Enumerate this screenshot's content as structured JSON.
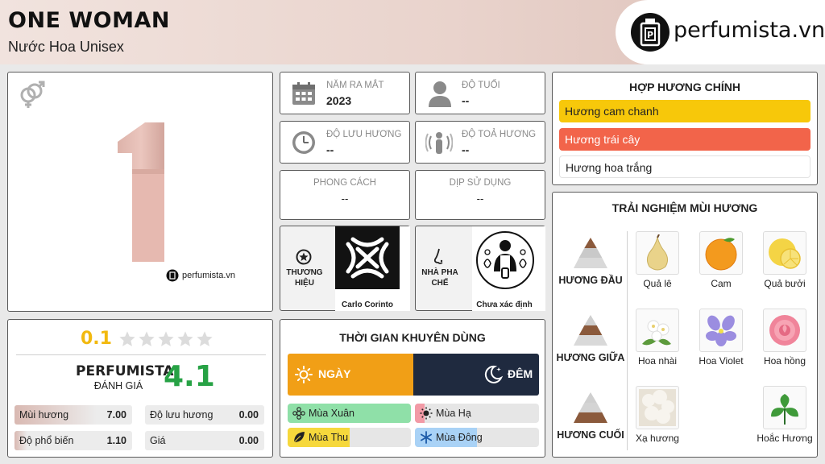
{
  "header": {
    "title": "ONE WOMAN",
    "subtitle": "Nước Hoa Unisex",
    "logo_text": "perfumista.vn"
  },
  "product": {
    "watermark": "perfumista.vn"
  },
  "info": {
    "launch_year": {
      "label": "NĂM RA MẮT",
      "value": "2023"
    },
    "age": {
      "label": "ĐỘ TUỔI",
      "value": "--"
    },
    "longevity": {
      "label": "ĐỘ LƯU HƯƠNG",
      "value": "--"
    },
    "sillage": {
      "label": "ĐỘ TOẢ HƯƠNG",
      "value": "--"
    },
    "style": {
      "label": "PHONG CÁCH",
      "value": "--"
    },
    "occasion": {
      "label": "DỊP SỬ DỤNG",
      "value": "--"
    },
    "brand": {
      "label_line1": "THƯƠNG",
      "label_line2": "HIỆU",
      "name": "Carlo Corinto"
    },
    "perfumer": {
      "label_line1": "NHÀ PHA",
      "label_line2": "CHẾ",
      "name": "Chưa xác định"
    }
  },
  "accords": {
    "title": "HỢP HƯƠNG CHÍNH",
    "items": [
      {
        "label": "Hương cam chanh",
        "color": "#f7c80a"
      },
      {
        "label": "Hương trái cây",
        "color": "#f2644a"
      },
      {
        "label": "Hương hoa trắng",
        "color": "#ffffff"
      }
    ]
  },
  "notes": {
    "title": "TRẢI NGHIỆM MÙI HƯƠNG",
    "groups": [
      {
        "label": "HƯƠNG ĐẦU",
        "items": [
          "Quả lê",
          "Cam",
          "Quả bưởi"
        ]
      },
      {
        "label": "HƯƠNG GIỮA",
        "items": [
          "Hoa nhài",
          "Hoa Violet",
          "Hoa hồng"
        ]
      },
      {
        "label": "HƯƠNG CUỐI",
        "items": [
          "Xạ hương",
          "Hoắc Hương"
        ]
      }
    ]
  },
  "rating": {
    "user_score": "0.1",
    "stars_total": 5,
    "brand_label": "PERFUMISTA",
    "brand_sub": "ĐÁNH GIÁ",
    "brand_score": "4.1",
    "bars": [
      {
        "label": "Mùi hương",
        "value": "7.00",
        "fraction": 0.7
      },
      {
        "label": "Độ lưu hương",
        "value": "0.00",
        "fraction": 0
      },
      {
        "label": "Độ phổ biến",
        "value": "1.10",
        "fraction": 0.11
      },
      {
        "label": "Giá",
        "value": "0.00",
        "fraction": 0
      }
    ]
  },
  "time": {
    "title": "THỜI GIAN KHUYÊN DÙNG",
    "day": "NGÀY",
    "night": "ĐÊM",
    "seasons": [
      {
        "label": "Mùa Xuân",
        "fraction": 1.0,
        "color": "#8fe0a8"
      },
      {
        "label": "Mùa Hạ",
        "fraction": 0.08,
        "color": "#f29aa6"
      },
      {
        "label": "Mùa Thu",
        "fraction": 0.5,
        "color": "#f6d83c"
      },
      {
        "label": "Mùa Đông",
        "fraction": 0.5,
        "color": "#a9d2f6"
      }
    ]
  }
}
